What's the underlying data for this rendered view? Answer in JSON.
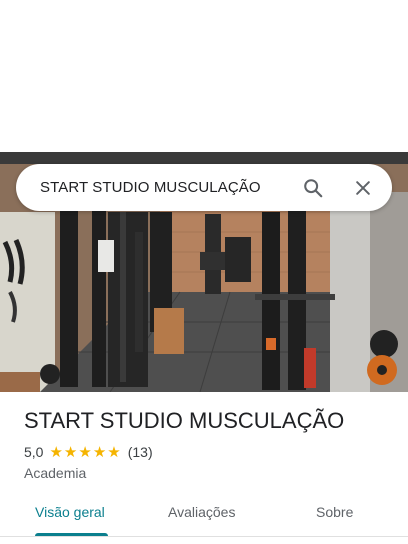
{
  "search": {
    "query": "START STUDIO MUSCULAÇÃO",
    "search_icon": "search-icon",
    "close_icon": "close-icon"
  },
  "place": {
    "title": "START STUDIO MUSCULAÇÃO",
    "rating": "5,0",
    "stars": 5,
    "reviews_count": "(13)",
    "category": "Academia",
    "photo_icon": "gym-photo"
  },
  "tabs": [
    {
      "label": "Visão geral",
      "active": true
    },
    {
      "label": "Avaliações",
      "active": false
    },
    {
      "label": "Sobre",
      "active": false
    }
  ],
  "colors": {
    "accent": "#0b7f8e",
    "star": "#f5b400",
    "text_primary": "#202124",
    "text_secondary": "#5f6368"
  }
}
